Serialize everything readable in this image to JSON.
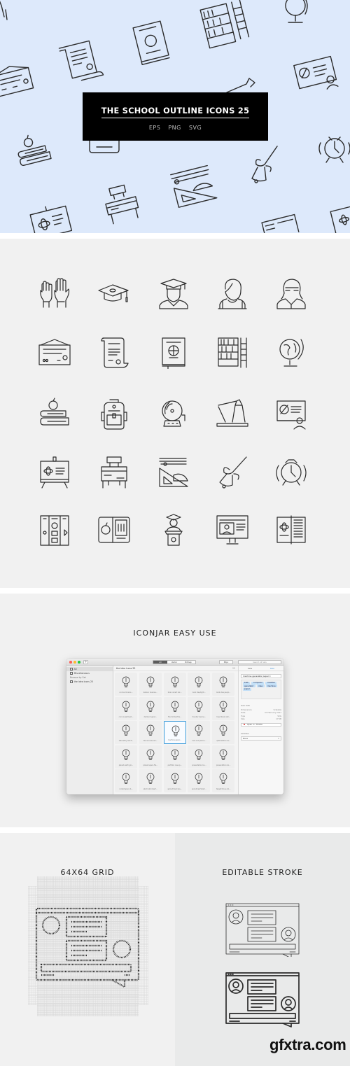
{
  "hero": {
    "title": "THE SCHOOL OUTLINE ICONS 25",
    "formats": [
      "EPS",
      "PNG",
      "SVG"
    ],
    "background_color": "#dde9fb"
  },
  "icon_grid": {
    "rows": [
      [
        "raised-hands-icon",
        "graduation-cap-icon",
        "graduate-student-icon",
        "schoolboy-icon",
        "teacher-icon"
      ],
      [
        "diploma-frame-icon",
        "certificate-scroll-icon",
        "brain-book-icon",
        "bookshelf-ladder-icon",
        "globe-icon"
      ],
      [
        "books-apple-icon",
        "backpack-icon",
        "school-bell-icon",
        "desk-lamp-icon",
        "online-teacher-board-icon"
      ],
      [
        "easel-board-icon",
        "school-desk-icon",
        "ruler-protractor-icon",
        "hand-bell-icon",
        "alarm-clock-icon"
      ],
      [
        "school-lockers-icon",
        "tablet-apple-icon",
        "graduation-speech-icon",
        "e-learning-monitor-icon",
        "open-book-science-icon"
      ]
    ]
  },
  "iconjar": {
    "heading": "ICONJAR EASY USE",
    "window": {
      "traffic_lights": [
        "#fe5f57",
        "#febc2e",
        "#28c840"
      ],
      "add_button": "+",
      "segments": [
        {
          "label": "All",
          "active": true
        },
        {
          "label": "Vector",
          "active": false
        },
        {
          "label": "Bitmap",
          "active": false
        }
      ],
      "size_selector": "88px",
      "search_placeholder": "Search All Sets"
    },
    "sidebar": {
      "items": [
        {
          "label": "All",
          "selected": true
        },
        {
          "label": "Miscellaneous",
          "selected": false
        }
      ],
      "browse_heading": "Browse by Set",
      "sets": [
        {
          "label": "the idea icons 25"
        }
      ]
    },
    "main": {
      "set_title": "the idea icons 25",
      "count": "25",
      "tiles": [
        "ai cloud brains...",
        "balloon busines...",
        "brain smart bul...",
        "bulb idea/light...",
        "bulb idea peopl...",
        "coin investment...",
        "diamond good...",
        "fire hot bonfire...",
        "founder busine...",
        "head brain stor...",
        "laboratory lab fl...",
        "like success am...",
        "machine gener...",
        "man surf job bu...",
        "optimization se...",
        "planet earth glo...",
        "planet space fla...",
        "portfolio case p...",
        "presentation bu...",
        "presentation bo...",
        "rocket space b...",
        "skull bulb idea f...",
        "sprout hand lea...",
        "sprout leaf start...",
        "target focus am..."
      ],
      "selected_index": 12
    },
    "inspector": {
      "tabs": [
        {
          "label": "Sets",
          "active": false
        },
        {
          "label": "Icon",
          "active": true
        }
      ],
      "icon_name": "machine generator paper li",
      "tags": [
        "bulb",
        "computer",
        "creative",
        "generator",
        "idea",
        "machine",
        "paper"
      ],
      "info_title": "Icon Info",
      "info": [
        {
          "key": "Dimensions",
          "value": "Scalable"
        },
        {
          "key": "Date",
          "value": "07 February 2017"
        },
        {
          "key": "Type",
          "value": "SVG"
        },
        {
          "key": "Size",
          "value": "17 KB"
        }
      ],
      "open_in": "Open in : Firefox",
      "license_title": "License",
      "license_value": "None"
    }
  },
  "bottom": {
    "grid_heading": "64X64 GRID",
    "stroke_heading": "EDITABLE STROKE",
    "watermark": "gfxtra.com"
  }
}
